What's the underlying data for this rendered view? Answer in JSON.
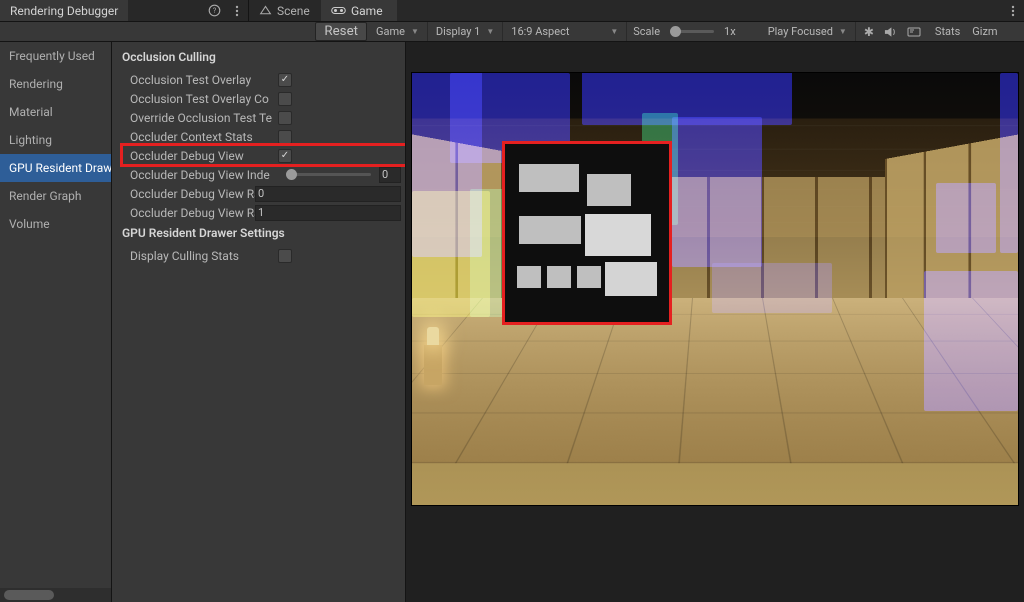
{
  "window": {
    "title": "Rendering Debugger"
  },
  "topbar": {
    "help_icon": "help-icon",
    "more_icon": "more-vert-icon",
    "tabs": {
      "scene": {
        "label": "Scene",
        "icon": "scene-icon"
      },
      "game": {
        "label": "Game",
        "icon": "game-goggles-icon"
      }
    },
    "right_more_icon": "more-vert-icon"
  },
  "toolbar": {
    "reset_label": "Reset",
    "target": {
      "value": "Game"
    },
    "display": {
      "value": "Display 1"
    },
    "aspect": {
      "value": "16:9 Aspect"
    },
    "scale_label": "Scale",
    "scale_value": "1x",
    "play_mode": {
      "value": "Play Focused"
    },
    "icons": {
      "mute": "mute-icon",
      "audio": "speaker-icon",
      "effects": "fx-icon"
    },
    "stats_label": "Stats",
    "gizmos_label": "Gizm"
  },
  "sidebar": {
    "items": [
      "Frequently Used",
      "Rendering",
      "Material",
      "Lighting",
      "GPU Resident Draw",
      "Render Graph",
      "Volume"
    ],
    "selected_index": 4
  },
  "inspector": {
    "sections": [
      {
        "header": "Occlusion Culling",
        "props": [
          {
            "label": "Occlusion Test Overlay",
            "type": "check",
            "value": true
          },
          {
            "label": "Occlusion Test Overlay Co",
            "type": "check",
            "value": false
          },
          {
            "label": "Override Occlusion Test Te",
            "type": "check",
            "value": false
          },
          {
            "label": "Occluder Context Stats",
            "type": "check",
            "value": false
          },
          {
            "label": "Occluder Debug View",
            "type": "check",
            "value": true,
            "highlight": true
          },
          {
            "label": "Occluder Debug View Inde",
            "type": "slider",
            "value": "0"
          },
          {
            "label": "Occluder Debug View Ran",
            "type": "number",
            "value": "0"
          },
          {
            "label": "Occluder Debug View Ran",
            "type": "number",
            "value": "1"
          }
        ]
      },
      {
        "header": "GPU Resident Drawer Settings",
        "props": [
          {
            "label": "Display Culling Stats",
            "type": "check",
            "value": false
          }
        ]
      }
    ]
  },
  "viewport": {
    "debug_overlay": {
      "name": "occluder-debug-view-overlay"
    }
  }
}
